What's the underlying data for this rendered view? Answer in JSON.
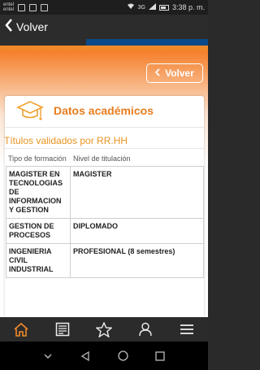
{
  "status": {
    "carrier_top": "entel",
    "carrier_bottom": "entel",
    "network": "3G",
    "time": "3:38 p. m."
  },
  "appbar": {
    "back_label": "Volver"
  },
  "content": {
    "volver_button": "Volver",
    "card_title": "Datos académicos",
    "subtitle": "Títulos validados por RR.HH",
    "columns": [
      "Tipo de formación",
      "Nivel de titulación"
    ],
    "rows": [
      {
        "tipo": "MAGISTER EN TECNOLOGIAS DE INFORMACION Y GESTION",
        "nivel": "MAGISTER"
      },
      {
        "tipo": "GESTION DE PROCESOS",
        "nivel": "DIPLOMADO"
      },
      {
        "tipo": "INGENIERIA CIVIL INDUSTRIAL",
        "nivel": "PROFESIONAL (8 semestres)"
      }
    ]
  },
  "bottom_nav": [
    "home-icon",
    "news-icon",
    "star-icon",
    "profile-icon",
    "menu-icon"
  ],
  "colors": {
    "accent": "#e87d1e",
    "active_nav": "#f08a2a"
  }
}
